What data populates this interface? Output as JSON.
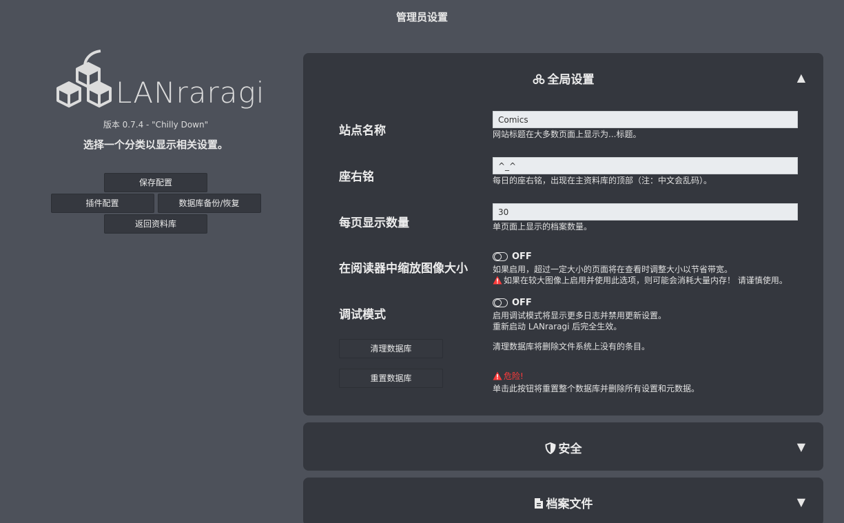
{
  "page": {
    "title": "管理员设置"
  },
  "left": {
    "logo_text": "LANraragi",
    "version": "版本 0.7.4 - \"Chilly Down\"",
    "hint": "选择一个分类以显示相关设置。",
    "buttons": {
      "save": "保存配置",
      "plugins": "插件配置",
      "backup": "数据库备份/恢复",
      "return": "返回资料库"
    }
  },
  "global": {
    "title": "全局设置",
    "icon": "cogs-icon",
    "expanded": true,
    "site_name": {
      "label": "站点名称",
      "value": "Comics",
      "desc": "网站标题在大多数页面上显示为...标题。"
    },
    "motd": {
      "label": "座右铭",
      "value": "^_^",
      "desc": "每日的座右铭，出现在主资料库的顶部（注：中文会乱码）。"
    },
    "per_page": {
      "label": "每页显示数量",
      "value": "30",
      "desc": "单页面上显示的档案数量。"
    },
    "resize": {
      "label": "在阅读器中缩放图像大小",
      "state": "OFF",
      "desc": "如果启用，超过一定大小的页面将在查看时调整大小以节省带宽。",
      "warning": "如果在较大图像上启用并使用此选项，则可能会消耗大量内存！ 请谨慎使用。"
    },
    "debug": {
      "label": "调试模式",
      "state": "OFF",
      "desc1": "启用调试模式将显示更多日志并禁用更新设置。",
      "desc2": "重新启动 LANraragi 后完全生效。"
    },
    "clean_db": {
      "button": "清理数据库",
      "desc": "清理数据库将删除文件系统上没有的条目。"
    },
    "reset_db": {
      "button": "重置数据库",
      "danger": "危险!",
      "desc": "单击此按钮将重置整个数据库并删除所有设置和元数据。"
    }
  },
  "security": {
    "title": "安全",
    "icon": "shield-icon",
    "expanded": false
  },
  "archive": {
    "title": "档案文件",
    "icon": "file-icon",
    "expanded": false
  },
  "arrows": {
    "up": "▲",
    "down": "▼"
  },
  "colors": {
    "background": "#4d515a",
    "panel": "#34373e",
    "danger": "#ff3b3b"
  }
}
